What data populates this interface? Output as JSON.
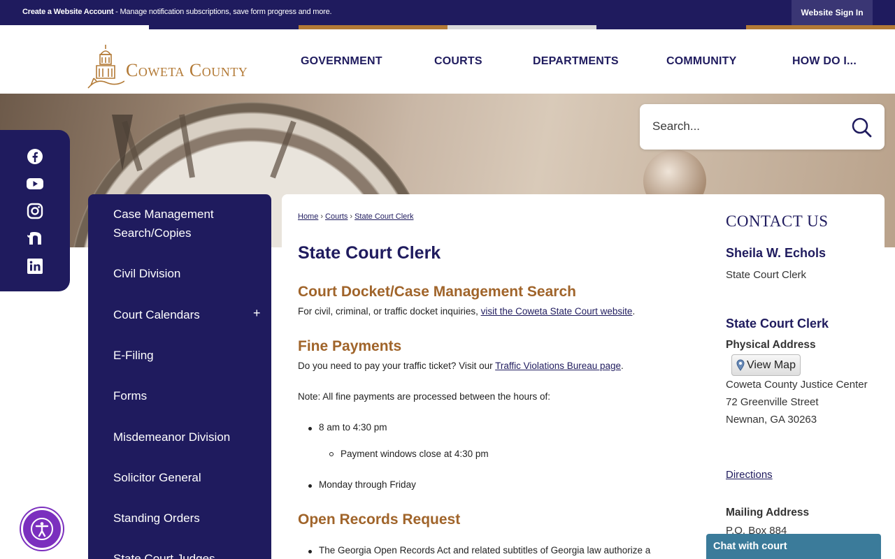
{
  "topbar": {
    "create_label": "Create a Website Account",
    "create_desc": " - Manage notification subscriptions, save form progress and more.",
    "signin_label": "Website Sign In",
    "stripe_colors": [
      "#1f1b5e",
      "#1f1b5e",
      "#b37a36",
      "#d9d9d9",
      "#1f1b5e",
      "#b37a36"
    ]
  },
  "header": {
    "logo_text": "Coweta County",
    "nav": [
      {
        "label": "GOVERNMENT"
      },
      {
        "label": "COURTS"
      },
      {
        "label": "DEPARTMENTS"
      },
      {
        "label": "COMMUNITY"
      },
      {
        "label": "HOW DO I..."
      }
    ]
  },
  "search": {
    "placeholder": "Search..."
  },
  "social": [
    "facebook-icon",
    "youtube-icon",
    "instagram-icon",
    "nextdoor-icon",
    "linkedin-icon"
  ],
  "sidenav": {
    "items": [
      {
        "label": "Case Management Search/Copies"
      },
      {
        "label": "Civil Division"
      },
      {
        "label": "Court Calendars",
        "expand": "+"
      },
      {
        "label": "E-Filing"
      },
      {
        "label": "Forms"
      },
      {
        "label": "Misdemeanor Division"
      },
      {
        "label": "Solicitor General"
      },
      {
        "label": "Standing Orders"
      },
      {
        "label": "State Court Judges"
      }
    ]
  },
  "breadcrumb": {
    "items": [
      "Home",
      "Courts",
      "State Court Clerk"
    ],
    "separator": "›"
  },
  "main": {
    "title": "State Court Clerk",
    "docket": {
      "heading": "Court Docket/Case Management Search",
      "text": "For civil, criminal, or traffic docket inquiries, ",
      "link": "visit the Coweta State Court website",
      "end": "."
    },
    "fines": {
      "heading": "Fine Payments",
      "text": "Do you need to pay your traffic ticket? Visit our ",
      "link": "Traffic Violations Bureau page",
      "end": ".",
      "note": "Note: All fine payments are processed between the hours of:",
      "hours": "8 am to 4:30 pm",
      "sub": "Payment windows close at 4:30 pm",
      "days": "Monday through Friday"
    },
    "records": {
      "heading": "Open Records Request",
      "text": "The Georgia Open Records Act and related subtitles of Georgia law authorize a"
    }
  },
  "contact": {
    "heading": "CONTACT US",
    "name": "Sheila W. Echols",
    "role": "State Court Clerk",
    "dept": "State Court Clerk",
    "physical_label": "Physical Address",
    "map_button": "View Map",
    "address": [
      "Coweta County Justice Center",
      "72 Greenville Street",
      "Newnan, GA 30263"
    ],
    "directions": "Directions",
    "mailing_label": "Mailing Address",
    "po_box": "P.O. Box 884"
  },
  "chat": {
    "label": "Chat with court"
  }
}
